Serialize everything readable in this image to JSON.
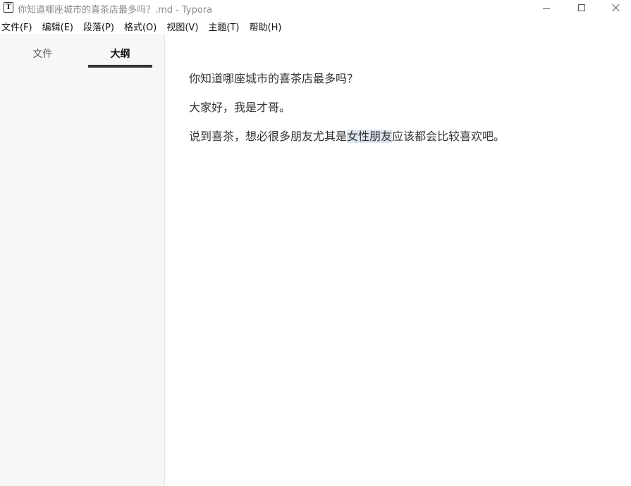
{
  "window": {
    "app_icon_letter": "T",
    "title": "你知道哪座城市的喜茶店最多吗？.md - Typora",
    "controls": {
      "minimize_icon": "minimize-icon",
      "maximize_icon": "maximize-icon",
      "close_icon": "close-icon"
    }
  },
  "menu": [
    "文件(F)",
    "编辑(E)",
    "段落(P)",
    "格式(O)",
    "视图(V)",
    "主题(T)",
    "帮助(H)"
  ],
  "sidebar": {
    "tabs": [
      "文件",
      "大纲"
    ],
    "active_tab": "大纲"
  },
  "editor": {
    "paragraphs": [
      {
        "text": "你知道哪座城市的喜茶店最多吗？"
      },
      {
        "text": "大家好，我是才哥。"
      },
      {
        "before": "说到喜茶，想必很多朋友尤其是",
        "highlight": "女性朋友",
        "after": "应该都会比较喜欢吧。"
      }
    ]
  },
  "colors": {
    "sidebar_bg": "#f7f7f7",
    "text": "#333333",
    "selection_highlight": "#dde5ee",
    "active_tab_underline": "#333333"
  }
}
